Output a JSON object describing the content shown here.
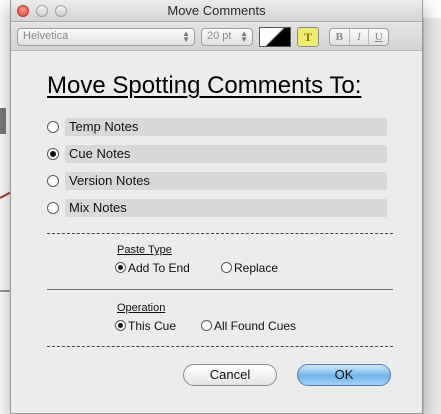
{
  "window": {
    "title": "Move Comments"
  },
  "toolbar": {
    "font_name": "Helvetica",
    "font_size": "20 pt",
    "text_color_label": "T",
    "bold_label": "B",
    "italic_label": "I",
    "underline_label": "U"
  },
  "dialog": {
    "heading": "Move Spotting Comments To:",
    "options": [
      {
        "label": "Temp Notes",
        "selected": false
      },
      {
        "label": "Cue Notes",
        "selected": true
      },
      {
        "label": "Version Notes",
        "selected": false
      },
      {
        "label": "Mix Notes",
        "selected": false
      }
    ],
    "paste_type": {
      "label": "Paste Type",
      "choices": [
        {
          "label": "Add To End",
          "selected": true
        },
        {
          "label": "Replace",
          "selected": false
        }
      ]
    },
    "operation": {
      "label": "Operation",
      "choices": [
        {
          "label": "This Cue",
          "selected": true
        },
        {
          "label": "All Found Cues",
          "selected": false
        }
      ]
    },
    "buttons": {
      "cancel": "Cancel",
      "ok": "OK"
    }
  },
  "icons": {
    "close": "close-icon",
    "minimize": "minimize-icon",
    "zoom": "zoom-icon",
    "select_arrows": "up-down-arrows-icon"
  },
  "colors": {
    "ok_button": "#6fb4ec",
    "close_button": "#e0453a",
    "text_highlight": "#f1ec6e"
  }
}
